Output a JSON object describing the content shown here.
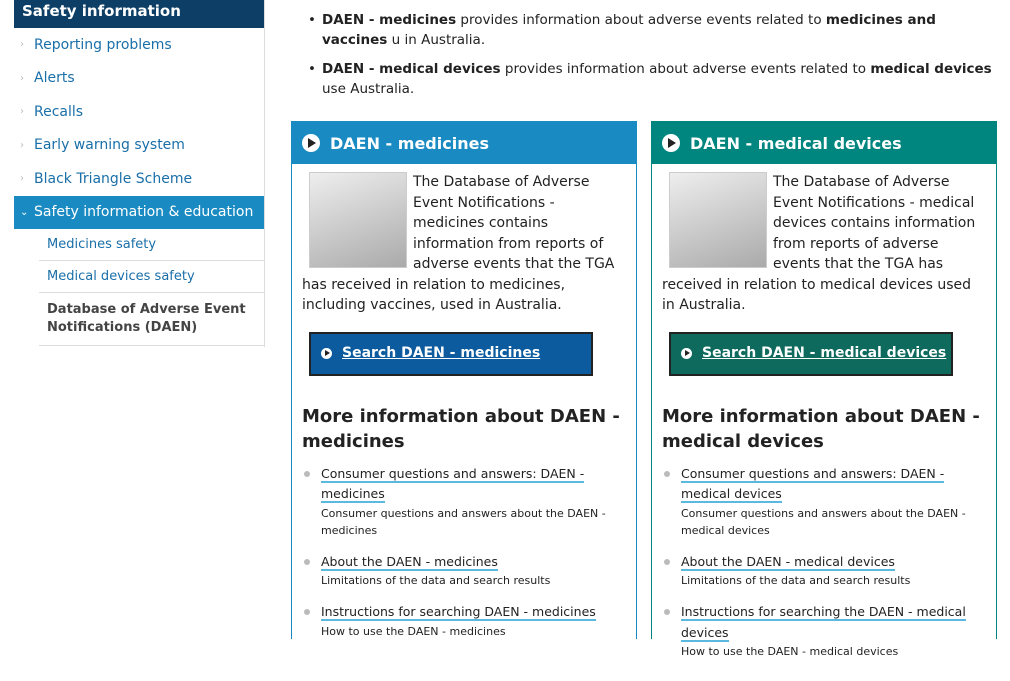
{
  "sidebar": {
    "title": "Safety information",
    "items": [
      {
        "label": "Reporting problems"
      },
      {
        "label": "Alerts"
      },
      {
        "label": "Recalls"
      },
      {
        "label": "Early warning system"
      },
      {
        "label": "Black Triangle Scheme"
      },
      {
        "label": "Safety information & education"
      }
    ],
    "subitems": [
      {
        "label": "Medicines safety"
      },
      {
        "label": "Medical devices safety"
      },
      {
        "label": "Database of Adverse Event Notifications (DAEN)"
      }
    ]
  },
  "intro": [
    {
      "b1": "DAEN - medicines",
      "t1": " provides information about adverse events related to ",
      "b2": "medicines and vaccines",
      "t2": " u",
      "line2": "in Australia."
    },
    {
      "b1": "DAEN - medical devices",
      "t1": " provides information about adverse events related to ",
      "b2": "medical devices",
      "t2": " use",
      "line2": "Australia."
    }
  ],
  "panels": [
    {
      "title": "DAEN - medicines",
      "color": "#1a8bc2",
      "button_color": "#0b5b9e",
      "image": "pills-photo",
      "desc": "The Database of Adverse Event Notifications - medicines contains information from reports of adverse events that the TGA has received in relation to medicines, including vaccines, used in Australia.",
      "button": "Search DAEN - medicines",
      "more": "More information about DAEN - medicines",
      "links": [
        {
          "title": "Consumer questions and answers: DAEN - medicines",
          "desc": "Consumer questions and answers about the DAEN - medicines"
        },
        {
          "title": "About the DAEN - medicines",
          "desc": "Limitations of the data and search results"
        },
        {
          "title": "Instructions for searching DAEN - medicines",
          "desc": "How to use the DAEN - medicines"
        }
      ]
    },
    {
      "title": "DAEN - medical devices",
      "color": "#00857f",
      "button_color": "#0f6a5e",
      "image": "medical-devices-photo",
      "desc": "The Database of Adverse Event Notifications - medical devices contains information from reports of adverse events that the TGA has received in relation to medical devices used in Australia.",
      "button": "Search DAEN - medical devices",
      "more": "More information about DAEN - medical devices",
      "links": [
        {
          "title": "Consumer questions and answers: DAEN - medical devices",
          "desc": "Consumer questions and answers about the DAEN - medical devices"
        },
        {
          "title": "About the DAEN - medical devices",
          "desc": "Limitations of the data and search results"
        },
        {
          "title": "Instructions for searching the DAEN - medical devices",
          "desc": "How to use the DAEN - medical devices"
        }
      ]
    }
  ]
}
